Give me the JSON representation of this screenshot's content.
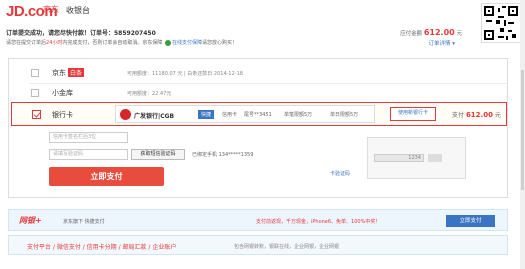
{
  "header": {
    "logo": "JD.com",
    "logo_cn": "京东",
    "page_title": "收银台",
    "order_line1": "订单提交成功，请您尽快付款！订单号：5859207450",
    "order_line2_a": "请您在提交订单后",
    "order_line2_red": "24小时",
    "order_line2_b": "内完成支付，否则订单会自动取消。京东保障",
    "order_line2_blue": "在线支付保障",
    "order_line2_c": "请您放心购买！",
    "total_label": "应付金额",
    "total_amount": "612.00",
    "total_unit": "元",
    "detail_link": "订单详情 ▾"
  },
  "payments": {
    "jd_baitiao_name": "京东",
    "jd_baitiao_badge": "白条",
    "jd_baitiao_info": "可用额度：11180.07 元  |  白条还款日 2014-12-18",
    "xiaojinku_name": "小金库",
    "xiaojinku_info": "可用额度：22.47元",
    "bank_label": "银行卡",
    "bank_name": "广发银行|CGB",
    "bank_badge": "快捷",
    "card_type": "信用卡",
    "card_tail": "尾号**3451",
    "limit_single": "单笔限额5万",
    "limit_day": "单日限额5万",
    "other_card_button": "使用新银行卡",
    "pay_label": "支付",
    "pay_amount": "612.00",
    "pay_unit": "元"
  },
  "form": {
    "card_placeholder": "信用卡签名栏后3位",
    "code_placeholder": "请填写验证码",
    "get_code_button": "获取短信验证码",
    "phone_label": "已绑定手机",
    "phone_value": "134*****1359",
    "pay_button": "立即支付",
    "card_hint": "1234",
    "verify_code_label": "卡验证码"
  },
  "promo": {
    "brand": "网银+",
    "sub": "京东旗下 快捷支付",
    "hot": "支付前返现，千万现金，iPhone6、免单、100%中奖！",
    "apply_button": "立即支付"
  },
  "footer": {
    "text": "支付平台 / 微信支付 / 信用卡分期 / 邮局汇款 / 企业账户",
    "sub": "包含网银转账，银联在线，企业网银，企业网银"
  }
}
